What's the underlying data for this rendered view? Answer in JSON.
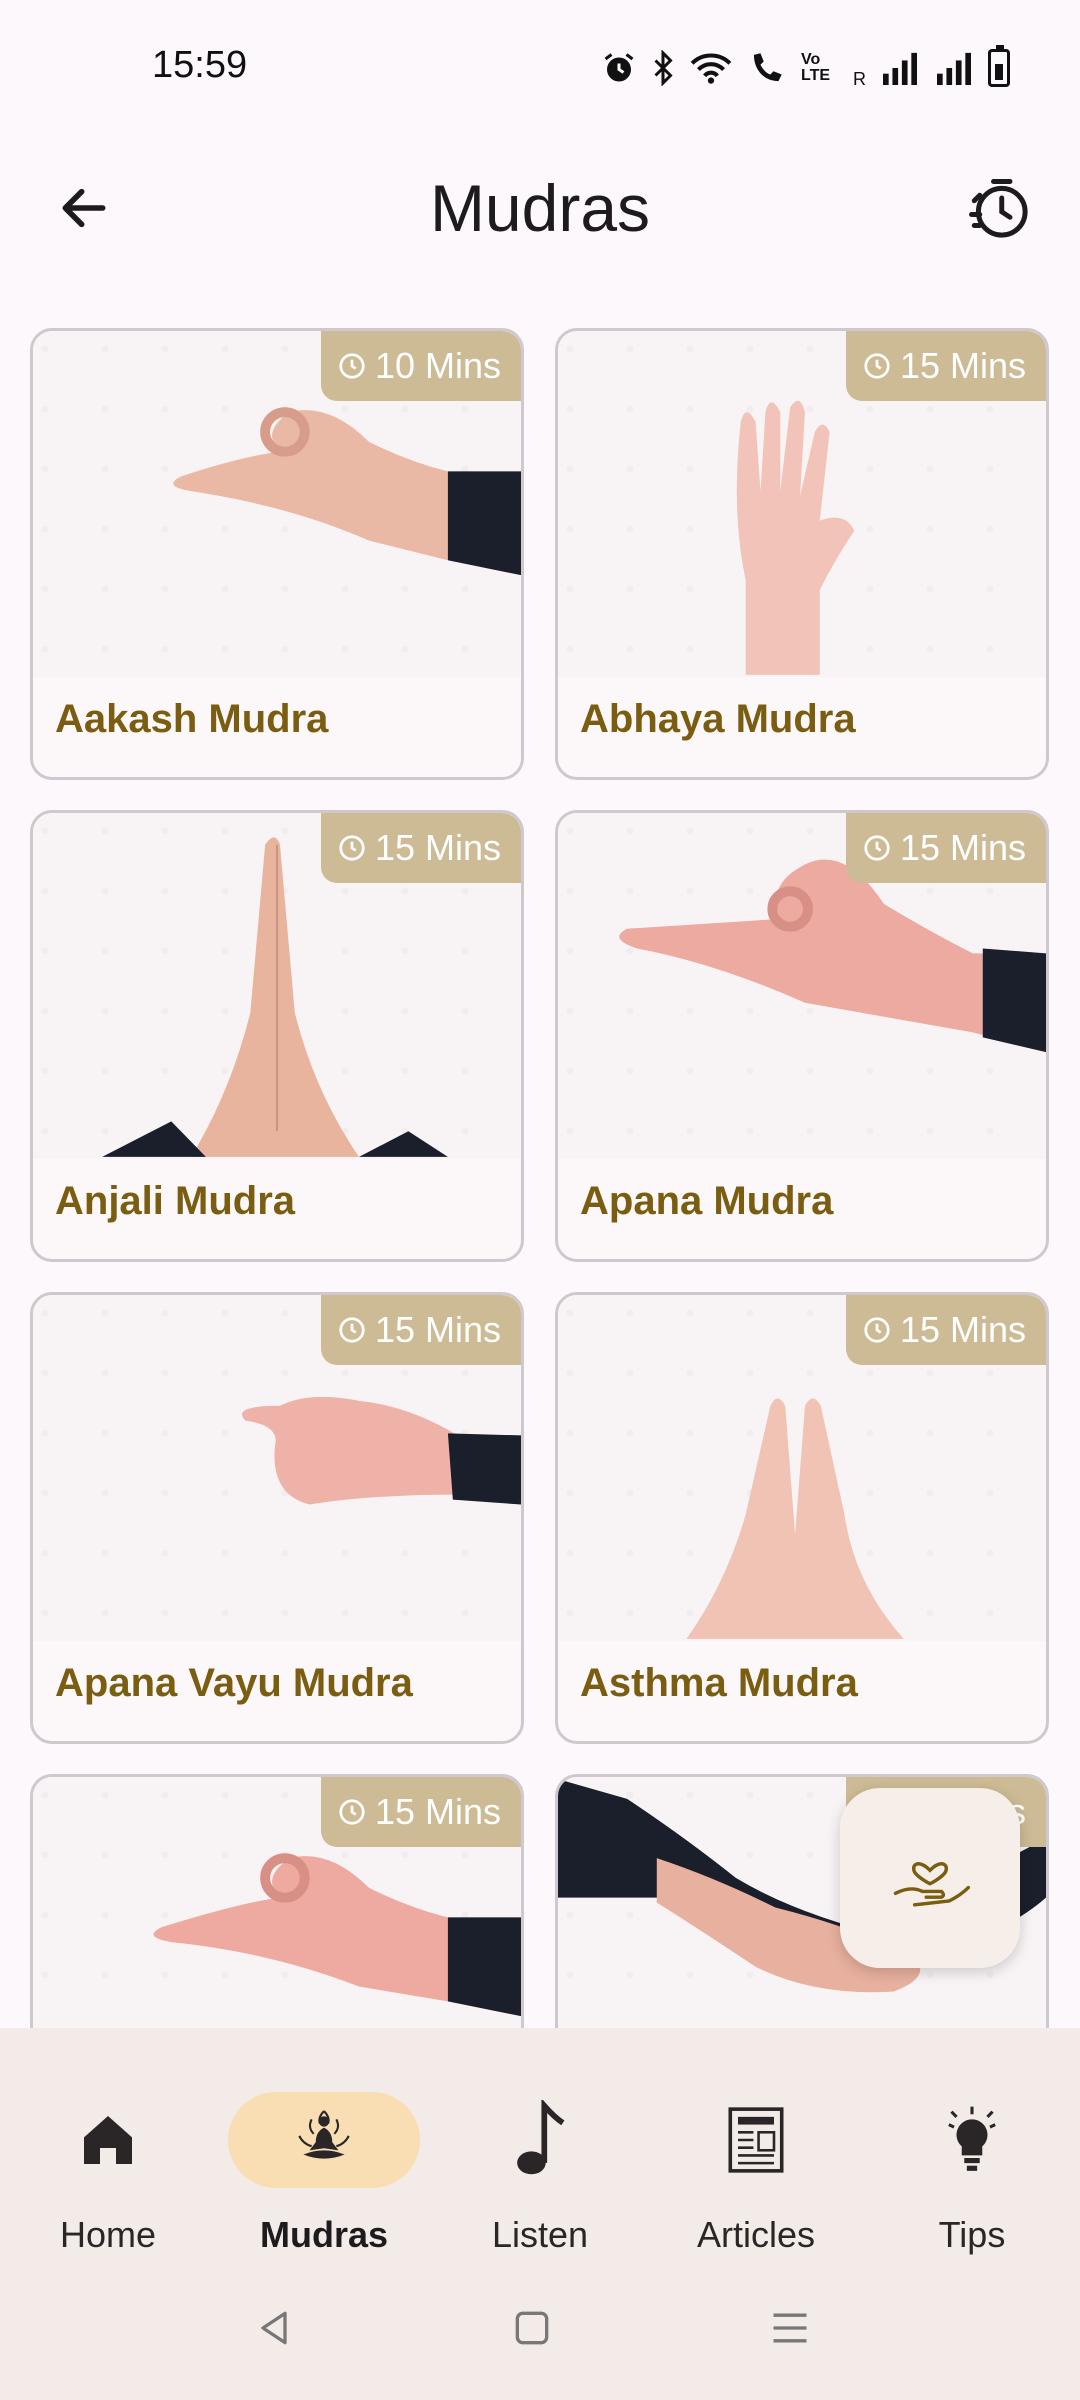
{
  "status": {
    "time": "15:59",
    "network_label": "Vo LTE",
    "roaming": "R"
  },
  "app_bar": {
    "title": "Mudras"
  },
  "mudras": [
    {
      "name": "Aakash Mudra",
      "duration": "10 Mins"
    },
    {
      "name": "Abhaya Mudra",
      "duration": "15 Mins"
    },
    {
      "name": "Anjali Mudra",
      "duration": "15 Mins"
    },
    {
      "name": "Apana Mudra",
      "duration": "15 Mins"
    },
    {
      "name": "Apana Vayu Mudra",
      "duration": "15 Mins"
    },
    {
      "name": "Asthma Mudra",
      "duration": "15 Mins"
    },
    {
      "name": "",
      "duration": "15 Mins"
    },
    {
      "name": "",
      "duration": "15 Mins"
    }
  ],
  "bottom_nav": {
    "items": [
      {
        "label": "Home",
        "icon": "home-icon"
      },
      {
        "label": "Mudras",
        "icon": "lotus-meditation-icon",
        "active": true
      },
      {
        "label": "Listen",
        "icon": "music-note-icon"
      },
      {
        "label": "Articles",
        "icon": "newspaper-icon"
      },
      {
        "label": "Tips",
        "icon": "lightbulb-icon"
      }
    ]
  },
  "colors": {
    "badge": "#cdbb95",
    "title_gold": "#7a5d10",
    "active_pill": "#f9deb4",
    "nav_bg": "#f3ebe7"
  }
}
